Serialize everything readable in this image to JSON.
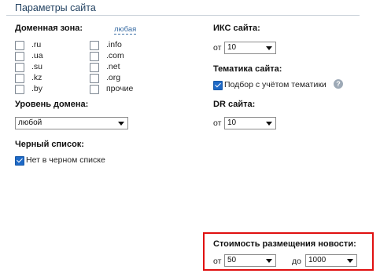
{
  "header": {
    "title": "Параметры сайта"
  },
  "domain_zone": {
    "label": "Доменная зона:",
    "any_link": "любая",
    "col1": [
      ".ru",
      ".ua",
      ".su",
      ".kz",
      ".by"
    ],
    "col2": [
      ".info",
      ".com",
      ".net",
      ".org",
      "прочие"
    ]
  },
  "domain_level": {
    "label": "Уровень домена:",
    "value": "любой"
  },
  "blacklist": {
    "label": "Черный список:",
    "checkbox_label": "Нет в черном списке",
    "checked": true
  },
  "iks": {
    "label": "ИКС сайта:",
    "from_label": "от",
    "value": "10"
  },
  "topic": {
    "label": "Тематика сайта:",
    "checkbox_label": "Подбор с учётом тематики",
    "checked": true,
    "help_symbol": "?"
  },
  "dr": {
    "label": "DR сайта:",
    "from_label": "от",
    "value": "10"
  },
  "price": {
    "label": "Стоимость размещения новости:",
    "from_label": "от",
    "from_value": "50",
    "to_label": "до",
    "to_value": "1000"
  },
  "colors": {
    "highlight_border": "#e01010",
    "checkbox_checked": "#1e69c6"
  }
}
